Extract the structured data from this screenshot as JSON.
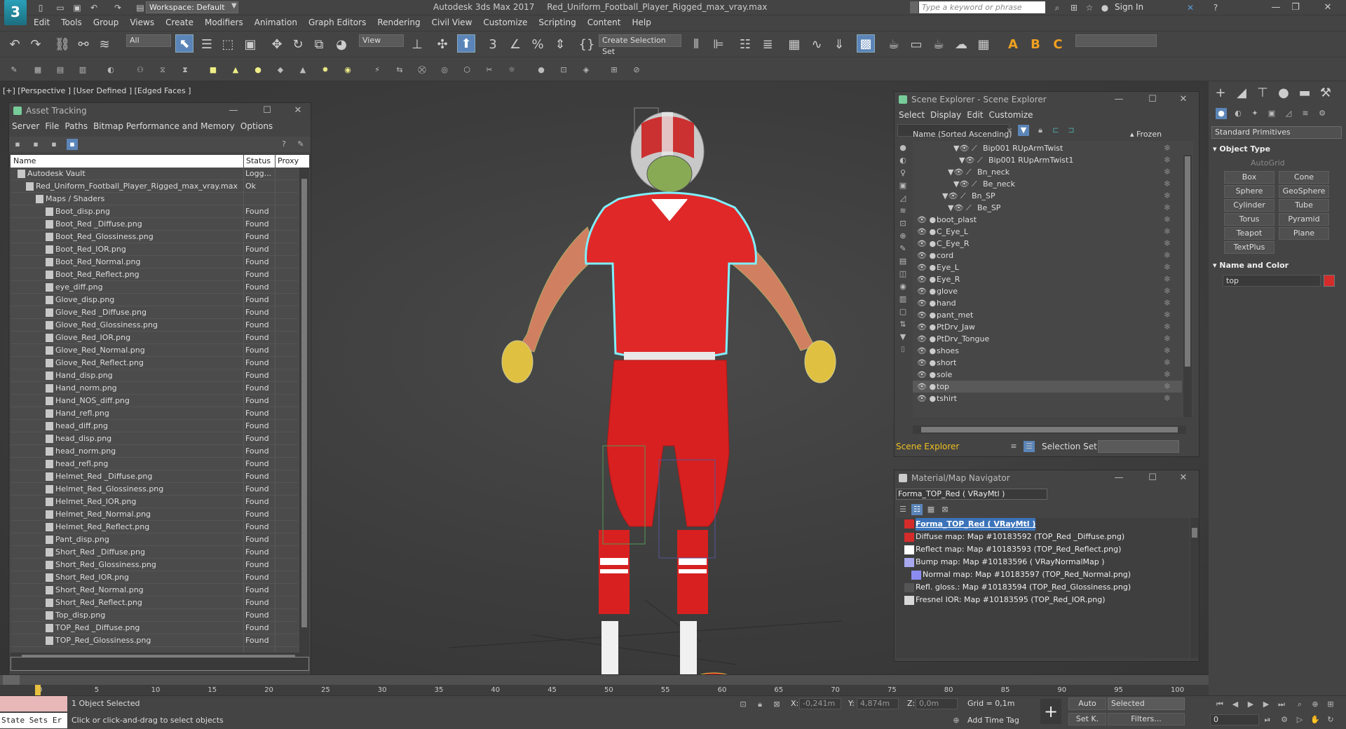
{
  "window": {
    "app_title": "Autodesk 3ds Max 2017",
    "file_title": "Red_Uniform_Football_Player_Rigged_max_vray.max",
    "workspace": "Workspace: Default",
    "search_placeholder": "Type a keyword or phrase",
    "signin": "Sign In",
    "logo": "3"
  },
  "menubar": [
    "Edit",
    "Tools",
    "Group",
    "Views",
    "Create",
    "Modifiers",
    "Animation",
    "Graph Editors",
    "Rendering",
    "Civil View",
    "Customize",
    "Scripting",
    "Content",
    "Help"
  ],
  "toolbar": {
    "filter": "All",
    "ref_coord": "View",
    "selection_set": "Create Selection Set"
  },
  "viewport": {
    "label": "[+] [Perspective ] [User Defined ] [Edged Faces ]"
  },
  "asset_tracking": {
    "title": "Asset Tracking",
    "menu": [
      "Server",
      "File",
      "Paths",
      "Bitmap Performance and Memory",
      "Options"
    ],
    "columns": [
      "Name",
      "Status",
      "Proxy"
    ],
    "rows": [
      {
        "name": "Autodesk Vault",
        "status": "Logg...",
        "indent": 0
      },
      {
        "name": "Red_Uniform_Football_Player_Rigged_max_vray.max",
        "status": "Ok",
        "indent": 1
      },
      {
        "name": "Maps / Shaders",
        "status": "",
        "indent": 2
      },
      {
        "name": "Boot_disp.png",
        "status": "Found",
        "indent": 3
      },
      {
        "name": "Boot_Red _Diffuse.png",
        "status": "Found",
        "indent": 3
      },
      {
        "name": "Boot_Red_Glossiness.png",
        "status": "Found",
        "indent": 3
      },
      {
        "name": "Boot_Red_IOR.png",
        "status": "Found",
        "indent": 3
      },
      {
        "name": "Boot_Red_Normal.png",
        "status": "Found",
        "indent": 3
      },
      {
        "name": "Boot_Red_Reflect.png",
        "status": "Found",
        "indent": 3
      },
      {
        "name": "eye_diff.png",
        "status": "Found",
        "indent": 3
      },
      {
        "name": "Glove_disp.png",
        "status": "Found",
        "indent": 3
      },
      {
        "name": "Glove_Red _Diffuse.png",
        "status": "Found",
        "indent": 3
      },
      {
        "name": "Glove_Red_Glossiness.png",
        "status": "Found",
        "indent": 3
      },
      {
        "name": "Glove_Red_IOR.png",
        "status": "Found",
        "indent": 3
      },
      {
        "name": "Glove_Red_Normal.png",
        "status": "Found",
        "indent": 3
      },
      {
        "name": "Glove_Red_Reflect.png",
        "status": "Found",
        "indent": 3
      },
      {
        "name": "Hand_disp.png",
        "status": "Found",
        "indent": 3
      },
      {
        "name": "Hand_norm.png",
        "status": "Found",
        "indent": 3
      },
      {
        "name": "Hand_NOS_diff.png",
        "status": "Found",
        "indent": 3
      },
      {
        "name": "Hand_refl.png",
        "status": "Found",
        "indent": 3
      },
      {
        "name": "head_diff.png",
        "status": "Found",
        "indent": 3
      },
      {
        "name": "head_disp.png",
        "status": "Found",
        "indent": 3
      },
      {
        "name": "head_norm.png",
        "status": "Found",
        "indent": 3
      },
      {
        "name": "head_refl.png",
        "status": "Found",
        "indent": 3
      },
      {
        "name": "Helmet_Red _Diffuse.png",
        "status": "Found",
        "indent": 3
      },
      {
        "name": "Helmet_Red_Glossiness.png",
        "status": "Found",
        "indent": 3
      },
      {
        "name": "Helmet_Red_IOR.png",
        "status": "Found",
        "indent": 3
      },
      {
        "name": "Helmet_Red_Normal.png",
        "status": "Found",
        "indent": 3
      },
      {
        "name": "Helmet_Red_Reflect.png",
        "status": "Found",
        "indent": 3
      },
      {
        "name": "Pant_disp.png",
        "status": "Found",
        "indent": 3
      },
      {
        "name": "Short_Red _Diffuse.png",
        "status": "Found",
        "indent": 3
      },
      {
        "name": "Short_Red_Glossiness.png",
        "status": "Found",
        "indent": 3
      },
      {
        "name": "Short_Red_IOR.png",
        "status": "Found",
        "indent": 3
      },
      {
        "name": "Short_Red_Normal.png",
        "status": "Found",
        "indent": 3
      },
      {
        "name": "Short_Red_Reflect.png",
        "status": "Found",
        "indent": 3
      },
      {
        "name": "Top_disp.png",
        "status": "Found",
        "indent": 3
      },
      {
        "name": "TOP_Red _Diffuse.png",
        "status": "Found",
        "indent": 3
      },
      {
        "name": "TOP_Red_Glossiness.png",
        "status": "Found",
        "indent": 3
      }
    ]
  },
  "scene_explorer": {
    "title": "Scene Explorer - Scene Explorer",
    "menu": [
      "Select",
      "Display",
      "Edit",
      "Customize"
    ],
    "col_name": "Name (Sorted Ascending)",
    "col_frozen": "▴ Frozen",
    "rows": [
      {
        "name": "Bip001 RUpArmTwist",
        "depth": 5,
        "selected": false
      },
      {
        "name": "Bip001 RUpArmTwist1",
        "depth": 6,
        "selected": false
      },
      {
        "name": "Bn_neck",
        "depth": 4,
        "selected": false
      },
      {
        "name": "Be_neck",
        "depth": 5,
        "selected": false
      },
      {
        "name": "Bn_SP",
        "depth": 3,
        "selected": false
      },
      {
        "name": "Be_SP",
        "depth": 4,
        "selected": false
      },
      {
        "name": "boot_plast",
        "depth": 0,
        "selected": false
      },
      {
        "name": "C_Eye_L",
        "depth": 0,
        "selected": false
      },
      {
        "name": "C_Eye_R",
        "depth": 0,
        "selected": false
      },
      {
        "name": "cord",
        "depth": 0,
        "selected": false
      },
      {
        "name": "Eye_L",
        "depth": 0,
        "selected": false
      },
      {
        "name": "Eye_R",
        "depth": 0,
        "selected": false
      },
      {
        "name": "glove",
        "depth": 0,
        "selected": false
      },
      {
        "name": "hand",
        "depth": 0,
        "selected": false
      },
      {
        "name": "pant_met",
        "depth": 0,
        "selected": false
      },
      {
        "name": "PtDrv_Jaw",
        "depth": 0,
        "selected": false
      },
      {
        "name": "PtDrv_Tongue",
        "depth": 0,
        "selected": false
      },
      {
        "name": "shoes",
        "depth": 0,
        "selected": false
      },
      {
        "name": "short",
        "depth": 0,
        "selected": false
      },
      {
        "name": "sole",
        "depth": 0,
        "selected": false
      },
      {
        "name": "top",
        "depth": 0,
        "selected": true
      },
      {
        "name": "tshirt",
        "depth": 0,
        "selected": false
      }
    ],
    "footer_label": "Scene Explorer",
    "selection_set_label": "Selection Set:"
  },
  "material_navigator": {
    "title": "Material/Map Navigator",
    "current": "Forma_TOP_Red  ( VRayMtl )",
    "root": "Forma_TOP_Red  ( VRayMtl )",
    "maps": [
      {
        "label": "Diffuse map: Map #10183592 (TOP_Red _Diffuse.png)",
        "swatch": "#d42b2b"
      },
      {
        "label": "Reflect map: Map #10183593 (TOP_Red_Reflect.png)",
        "swatch": "#ffffff"
      },
      {
        "label": "Bump map: Map #10183596  ( VRayNormalMap )",
        "swatch": "#a8a8ee"
      },
      {
        "label": "Normal map: Map #10183597 (TOP_Red_Normal.png)",
        "swatch": "#8c8cf0"
      },
      {
        "label": "Refl. gloss.: Map #10183594 (TOP_Red_Glossiness.png)",
        "swatch": "#555555"
      },
      {
        "label": "Fresnel IOR: Map #10183595 (TOP_Red_IOR.png)",
        "swatch": "#d8d8d8"
      }
    ]
  },
  "command_panel": {
    "category": "Standard Primitives",
    "object_type_title": "Object Type",
    "autogrid": "AutoGrid",
    "buttons": [
      "Box",
      "Cone",
      "Sphere",
      "GeoSphere",
      "Cylinder",
      "Tube",
      "Torus",
      "Pyramid",
      "Teapot",
      "Plane",
      "TextPlus"
    ],
    "name_color_title": "Name and Color",
    "object_name": "top",
    "object_color": "#d42b2b"
  },
  "timeline": {
    "frame": "0 / 100",
    "ticks": [
      "0",
      "5",
      "10",
      "15",
      "20",
      "25",
      "30",
      "35",
      "40",
      "45",
      "50",
      "55",
      "60",
      "65",
      "70",
      "75",
      "80",
      "85",
      "90",
      "95",
      "100"
    ]
  },
  "statusbar": {
    "maxscript": "State Sets Er",
    "selected": "1 Object Selected",
    "prompt": "Click or click-and-drag to select objects",
    "x_label": "X:",
    "x_value": "-0,241m",
    "y_label": "Y:",
    "y_value": "4,874m",
    "z_label": "Z:",
    "z_value": "0,0m",
    "grid": "Grid = 0,1m",
    "add_time_tag": "Add Time Tag",
    "auto": "Auto",
    "set_key": "Set K.",
    "selected_dropdown": "Selected",
    "filters": "Filters...",
    "frame_value": "0"
  }
}
